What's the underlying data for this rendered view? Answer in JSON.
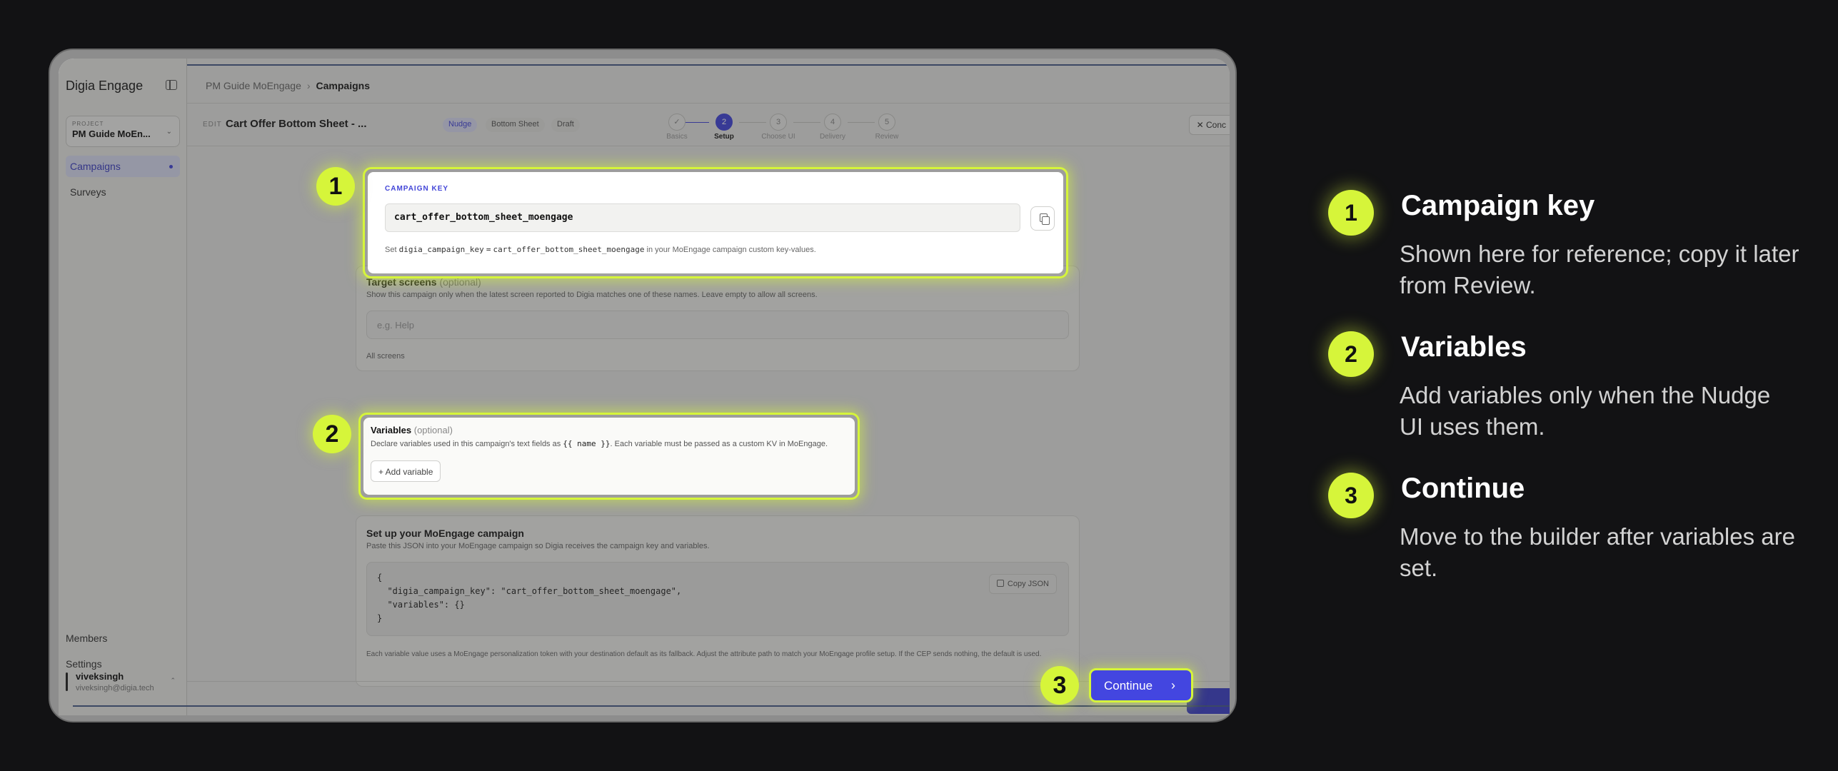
{
  "app": {
    "brand": "Digia Engage",
    "project_label": "PROJECT",
    "project_name": "PM Guide MoEn...",
    "nav": [
      "Campaigns",
      "Surveys"
    ],
    "footer_nav": [
      "Members",
      "Settings"
    ],
    "user_name": "viveksingh",
    "user_email": "viveksingh@digia.tech"
  },
  "breadcrumb": {
    "parent": "PM Guide MoEngage",
    "current": "Campaigns"
  },
  "editbar": {
    "edit_label": "EDIT",
    "title": "Cart Offer Bottom Sheet - ...",
    "chips": [
      "Nudge",
      "Bottom Sheet",
      "Draft"
    ],
    "steps": [
      {
        "num": "✓",
        "label": "Basics"
      },
      {
        "num": "2",
        "label": "Setup"
      },
      {
        "num": "3",
        "label": "Choose UI"
      },
      {
        "num": "4",
        "label": "Delivery"
      },
      {
        "num": "5",
        "label": "Review"
      }
    ],
    "close_label": "✕  Conc"
  },
  "campaign_key": {
    "label": "CAMPAIGN KEY",
    "value": "cart_offer_bottom_sheet_moengage",
    "help_prefix": "Set",
    "help_key": "digia_campaign_key",
    "help_eq": "=",
    "help_value": "cart_offer_bottom_sheet_moengage",
    "help_suffix": "in your MoEngage campaign custom key-values."
  },
  "target_screens": {
    "title": "Target screens",
    "optional": "(optional)",
    "desc": "Show this campaign only when the latest screen reported to Digia matches one of these names. Leave empty to allow all screens.",
    "placeholder": "e.g. Help",
    "hint": "All screens"
  },
  "variables": {
    "title": "Variables",
    "optional": "(optional)",
    "desc_prefix": "Declare variables used in this campaign's text fields as",
    "desc_code": "{{ name }}",
    "desc_suffix": ". Each variable must be passed as a custom KV in MoEngage.",
    "add_label": "+  Add variable"
  },
  "moengage": {
    "title": "Set up your MoEngage campaign",
    "desc": "Paste this JSON into your MoEngage campaign so Digia receives the campaign key and variables.",
    "json_lines": [
      "{",
      "  \"digia_campaign_key\": \"cart_offer_bottom_sheet_moengage\",",
      "  \"variables\": {}",
      "}"
    ],
    "copy_label": "Copy JSON",
    "footnote": "Each variable value uses a MoEngage personalization token with your destination default as its fallback. Adjust the attribute path to match your MoEngage profile setup. If the CEP sends nothing, the default is used."
  },
  "continue_label": "Continue",
  "continue_chev": "›",
  "badges": [
    "1",
    "2",
    "3"
  ],
  "legend": [
    {
      "num": "1",
      "title": "Campaign key",
      "desc": "Shown here for reference; copy it later from Review."
    },
    {
      "num": "2",
      "title": "Variables",
      "desc": "Add variables only when the Nudge UI uses them."
    },
    {
      "num": "3",
      "title": "Continue",
      "desc": "Move to the builder after variables are set."
    }
  ],
  "colors": {
    "accent": "#4346E0",
    "highlight": "#D6F53A",
    "background": "#121214"
  }
}
